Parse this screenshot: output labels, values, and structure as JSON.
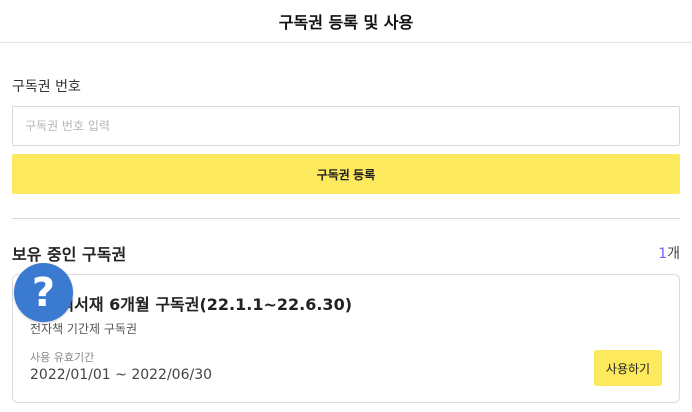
{
  "header": {
    "title": "구독권 등록 및 사용"
  },
  "register": {
    "label": "구독권 번호",
    "input_placeholder": "구독권 번호 입력",
    "input_value": "",
    "button_label": "구독권 등록"
  },
  "owned": {
    "title": "보유 중인 구독권",
    "count_number": "1",
    "count_unit": "개",
    "items": [
      {
        "title": "밀리의서재 6개월 구독권(22.1.1~22.6.30)",
        "subtitle": "전자책 기간제 구독권",
        "period_label": "사용 유효기간",
        "period": "2022/01/01 ~ 2022/06/30",
        "use_button_label": "사용하기"
      }
    ]
  },
  "help_icon": {
    "glyph": "?",
    "icon": "question-mark-icon",
    "color": "#3a7ad0"
  },
  "colors": {
    "accent": "#fde95e",
    "count_highlight": "#7b5cff"
  }
}
